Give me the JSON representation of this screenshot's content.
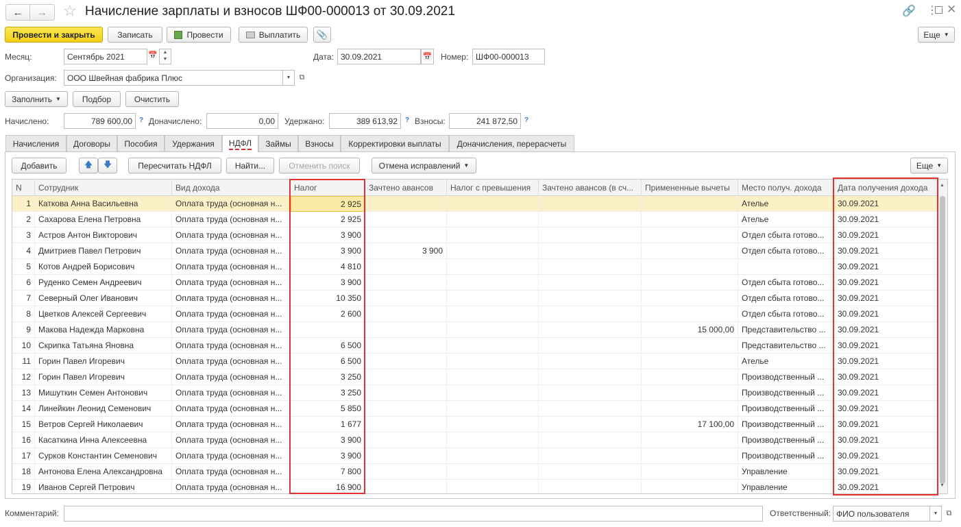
{
  "window": {
    "title": "Начисление зарплаты и взносов ШФ00-000013 от 30.09.2021"
  },
  "toolbar": {
    "post_close": "Провести и закрыть",
    "save": "Записать",
    "post": "Провести",
    "pay": "Выплатить",
    "more": "Еще"
  },
  "form": {
    "month_label": "Месяц:",
    "month_value": "Сентябрь 2021",
    "date_label": "Дата:",
    "date_value": "30.09.2021",
    "number_label": "Номер:",
    "number_value": "ШФ00-000013",
    "org_label": "Организация:",
    "org_value": "ООО Швейная фабрика Плюс",
    "fill": "Заполнить",
    "selection": "Подбор",
    "clear": "Очистить",
    "accrued_label": "Начислено:",
    "accrued_value": "789 600,00",
    "additional_label": "Доначислено:",
    "additional_value": "0,00",
    "withheld_label": "Удержано:",
    "withheld_value": "389 613,92",
    "contrib_label": "Взносы:",
    "contrib_value": "241 872,50",
    "q": "?"
  },
  "tabs": [
    "Начисления",
    "Договоры",
    "Пособия",
    "Удержания",
    "НДФЛ",
    "Займы",
    "Взносы",
    "Корректировки выплаты",
    "Доначисления, перерасчеты"
  ],
  "table_toolbar": {
    "add": "Добавить",
    "recalc": "Пересчитать НДФЛ",
    "find": "Найти...",
    "cancel_search": "Отменить поиск",
    "cancel_fixes": "Отмена исправлений",
    "more": "Еще"
  },
  "table": {
    "columns": [
      "N",
      "Сотрудник",
      "Вид дохода",
      "Налог",
      "Зачтено авансов",
      "Налог с превышения",
      "Зачтено авансов (в сч...",
      "Примененные вычеты",
      "Место получ. дохода",
      "Дата получения дохода"
    ],
    "rows": [
      {
        "n": "1",
        "emp": "Каткова Анна Васильевна",
        "kind": "Оплата труда (основная н...",
        "tax": "2 925",
        "adv": "",
        "over": "",
        "adv2": "",
        "ded": "",
        "place": "Ателье",
        "date": "30.09.2021"
      },
      {
        "n": "2",
        "emp": "Сахарова Елена Петровна",
        "kind": "Оплата труда (основная н...",
        "tax": "2 925",
        "adv": "",
        "over": "",
        "adv2": "",
        "ded": "",
        "place": "Ателье",
        "date": "30.09.2021"
      },
      {
        "n": "3",
        "emp": "Астров Антон Викторович",
        "kind": "Оплата труда (основная н...",
        "tax": "3 900",
        "adv": "",
        "over": "",
        "adv2": "",
        "ded": "",
        "place": "Отдел сбыта готово...",
        "date": "30.09.2021"
      },
      {
        "n": "4",
        "emp": "Дмитриев Павел Петрович",
        "kind": "Оплата труда (основная н...",
        "tax": "3 900",
        "adv": "3 900",
        "over": "",
        "adv2": "",
        "ded": "",
        "place": "Отдел сбыта готово...",
        "date": "30.09.2021"
      },
      {
        "n": "5",
        "emp": "Котов Андрей Борисович",
        "kind": "Оплата труда (основная н...",
        "tax": "4 810",
        "adv": "",
        "over": "",
        "adv2": "",
        "ded": "",
        "place": "",
        "date": "30.09.2021"
      },
      {
        "n": "6",
        "emp": "Руденко Семен Андреевич",
        "kind": "Оплата труда (основная н...",
        "tax": "3 900",
        "adv": "",
        "over": "",
        "adv2": "",
        "ded": "",
        "place": "Отдел сбыта готово...",
        "date": "30.09.2021"
      },
      {
        "n": "7",
        "emp": "Северный Олег Иванович",
        "kind": "Оплата труда (основная н...",
        "tax": "10 350",
        "adv": "",
        "over": "",
        "adv2": "",
        "ded": "",
        "place": "Отдел сбыта готово...",
        "date": "30.09.2021"
      },
      {
        "n": "8",
        "emp": "Цветков Алексей Сергеевич",
        "kind": "Оплата труда (основная н...",
        "tax": "2 600",
        "adv": "",
        "over": "",
        "adv2": "",
        "ded": "",
        "place": "Отдел сбыта готово...",
        "date": "30.09.2021"
      },
      {
        "n": "9",
        "emp": "Макова Надежда Марковна",
        "kind": "Оплата труда (основная н...",
        "tax": "",
        "adv": "",
        "over": "",
        "adv2": "",
        "ded": "15 000,00",
        "place": "Представительство ...",
        "date": "30.09.2021"
      },
      {
        "n": "10",
        "emp": "Скрипка Татьяна Яновна",
        "kind": "Оплата труда (основная н...",
        "tax": "6 500",
        "adv": "",
        "over": "",
        "adv2": "",
        "ded": "",
        "place": "Представительство ...",
        "date": "30.09.2021"
      },
      {
        "n": "11",
        "emp": "Горин Павел Игоревич",
        "kind": "Оплата труда (основная н...",
        "tax": "6 500",
        "adv": "",
        "over": "",
        "adv2": "",
        "ded": "",
        "place": "Ателье",
        "date": "30.09.2021"
      },
      {
        "n": "12",
        "emp": "Горин Павел Игоревич",
        "kind": "Оплата труда (основная н...",
        "tax": "3 250",
        "adv": "",
        "over": "",
        "adv2": "",
        "ded": "",
        "place": "Производственный ...",
        "date": "30.09.2021"
      },
      {
        "n": "13",
        "emp": "Мишуткин Семен Антонович",
        "kind": "Оплата труда (основная н...",
        "tax": "3 250",
        "adv": "",
        "over": "",
        "adv2": "",
        "ded": "",
        "place": "Производственный ...",
        "date": "30.09.2021"
      },
      {
        "n": "14",
        "emp": "Линейкин Леонид Семенович",
        "kind": "Оплата труда (основная н...",
        "tax": "5 850",
        "adv": "",
        "over": "",
        "adv2": "",
        "ded": "",
        "place": "Производственный ...",
        "date": "30.09.2021"
      },
      {
        "n": "15",
        "emp": "Ветров Сергей Николаевич",
        "kind": "Оплата труда (основная н...",
        "tax": "1 677",
        "adv": "",
        "over": "",
        "adv2": "",
        "ded": "17 100,00",
        "place": "Производственный ...",
        "date": "30.09.2021"
      },
      {
        "n": "16",
        "emp": "Касаткина Инна Алексеевна",
        "kind": "Оплата труда (основная н...",
        "tax": "3 900",
        "adv": "",
        "over": "",
        "adv2": "",
        "ded": "",
        "place": "Производственный ...",
        "date": "30.09.2021"
      },
      {
        "n": "17",
        "emp": "Сурков Константин Семенович",
        "kind": "Оплата труда (основная н...",
        "tax": "3 900",
        "adv": "",
        "over": "",
        "adv2": "",
        "ded": "",
        "place": "Производственный ...",
        "date": "30.09.2021"
      },
      {
        "n": "18",
        "emp": "Антонова Елена Александровна",
        "kind": "Оплата труда (основная н...",
        "tax": "7 800",
        "adv": "",
        "over": "",
        "adv2": "",
        "ded": "",
        "place": "Управление",
        "date": "30.09.2021"
      },
      {
        "n": "19",
        "emp": "Иванов Сергей Петрович",
        "kind": "Оплата труда (основная н...",
        "tax": "16 900",
        "adv": "",
        "over": "",
        "adv2": "",
        "ded": "",
        "place": "Управление",
        "date": "30.09.2021"
      }
    ]
  },
  "footer": {
    "comment_label": "Комментарий:",
    "comment_value": "",
    "responsible_label": "Ответственный:",
    "responsible_value": "ФИО пользователя"
  },
  "colors": {
    "primary_button": "#f3cf15",
    "selected_row": "#fbf0c6",
    "highlight_box": "#e53030",
    "arrow_blue": "#3b7ac4"
  },
  "icons": [
    "back-arrow-icon",
    "forward-arrow-icon",
    "star-icon",
    "link-icon",
    "kebab-menu-icon",
    "maximize-icon",
    "close-icon",
    "post-icon",
    "pay-icon",
    "paperclip-icon",
    "calendar-icon",
    "dropdown-arrow-icon",
    "open-icon",
    "up-arrow-icon",
    "down-arrow-icon"
  ]
}
